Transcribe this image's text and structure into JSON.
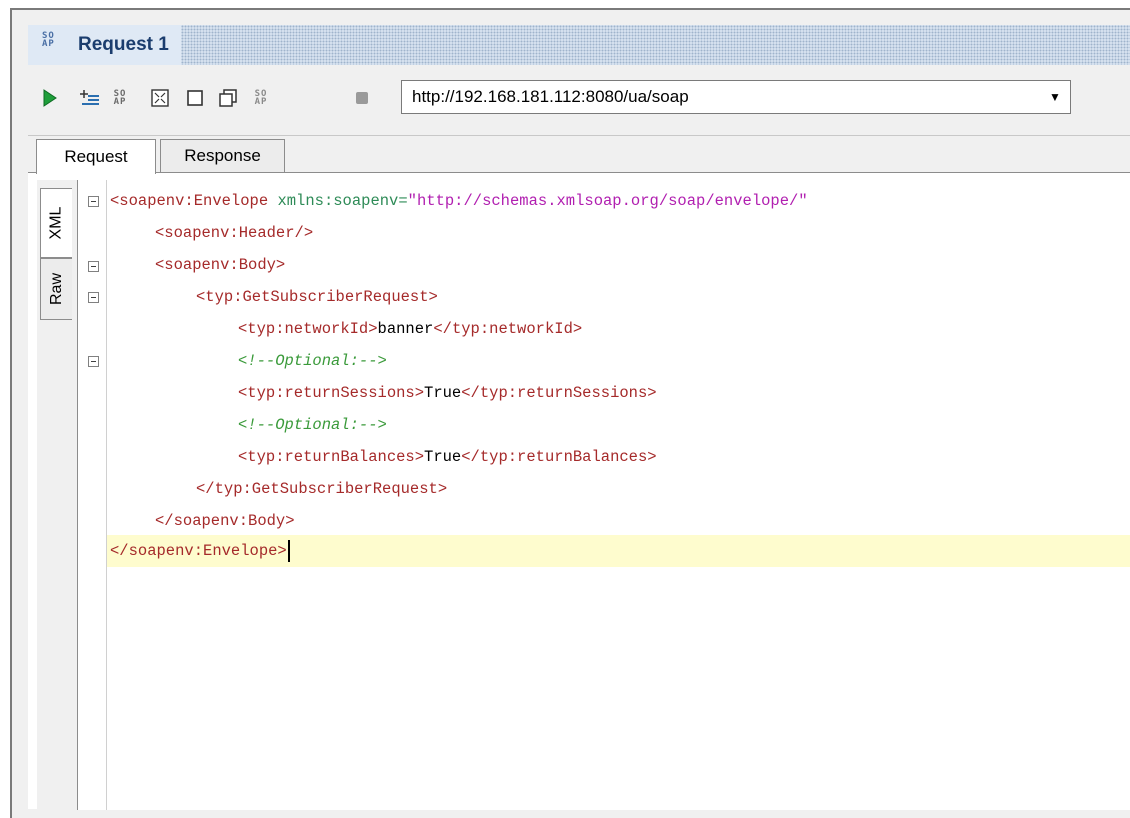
{
  "window": {
    "title": "Request 1",
    "title_icon_text": "SO\nAP"
  },
  "toolbar": {
    "submit_icon": "play-icon",
    "add_assertion_icon": "add-list-icon",
    "icons": [
      "soap-icon",
      "fit-icon",
      "square-icon",
      "copy-icon",
      "soap-small-icon",
      "stop-icon"
    ],
    "endpoint": "http://192.168.181.112:8080/ua/soap",
    "endpoint_arrow": "▼"
  },
  "tabs": [
    {
      "label": "Request",
      "active": true
    },
    {
      "label": "Response",
      "active": false
    }
  ],
  "side_tabs": [
    {
      "label": "XML",
      "active": true
    },
    {
      "label": "Raw",
      "active": false
    }
  ],
  "code": {
    "line1_tag": "<soapenv:Envelope ",
    "line1_attr": "xmlns:soapenv=",
    "line1_val": "\"http://schemas.xmlsoap.org/soap/envelope/\"",
    "line2": "<soapenv:Header/>",
    "line3": "<soapenv:Body>",
    "line4": "<typ:GetSubscriberRequest>",
    "line5_open": "<typ:networkId>",
    "line5_text": "banner",
    "line5_close": "</typ:networkId>",
    "line6": "<!--Optional:-->",
    "line7_open": "<typ:returnSessions>",
    "line7_text": "True",
    "line7_close": "</typ:returnSessions>",
    "line8": "<!--Optional:-->",
    "line9_open": "<typ:returnBalances>",
    "line9_text": "True",
    "line9_close": "</typ:returnBalances>",
    "line10": "</typ:GetSubscriberRequest>",
    "line11": "</soapenv:Body>",
    "line12": "</soapenv:Envelope>"
  },
  "colors": {
    "tag": "#a52a2a",
    "attribute": "#2e8b57",
    "attr_value": "#b11fb0",
    "comment": "#3a9a3a",
    "current_line": "#fefcce",
    "title_text": "#1b3d6e"
  }
}
